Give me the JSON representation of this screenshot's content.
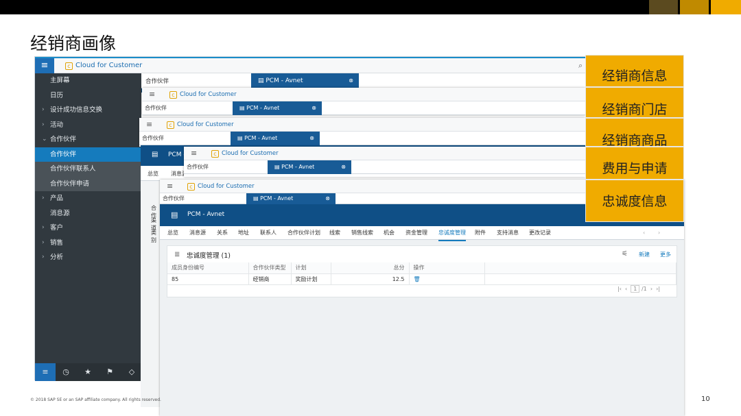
{
  "slide": {
    "title": "经销商画像",
    "footer": "© 2018 SAP SE or an SAP affiliate company. All rights reserved.",
    "page_number": "10",
    "accent_colors": [
      "#5b4a1f",
      "#c08a00",
      "#f0ab00"
    ]
  },
  "app": {
    "brand": "Cloud for Customer",
    "menu_icon": "hamburger-icon",
    "search_icon": "search-icon"
  },
  "sidebar": {
    "items": [
      {
        "label": "主屏幕",
        "chevron": ""
      },
      {
        "label": "日历",
        "chevron": ""
      },
      {
        "label": "设计成功信息交换",
        "chevron": "›"
      },
      {
        "label": "活动",
        "chevron": "›"
      },
      {
        "label": "合作伙伴",
        "chevron": "⌄"
      },
      {
        "label": "合作伙伴",
        "chevron": ""
      },
      {
        "label": "合作伙伴联系人",
        "chevron": ""
      },
      {
        "label": "合作伙伴申请",
        "chevron": ""
      },
      {
        "label": "产品",
        "chevron": "›"
      },
      {
        "label": "消息源",
        "chevron": ""
      },
      {
        "label": "客户",
        "chevron": "›"
      },
      {
        "label": "销售",
        "chevron": "›"
      },
      {
        "label": "分析",
        "chevron": "›"
      }
    ],
    "bottom_icons": [
      "hamburger-icon",
      "clock-icon",
      "star-icon",
      "flag-icon",
      "tag-icon"
    ]
  },
  "windows": {
    "partner_label": "合作伙伴",
    "tab_label": "PCM - Avnet",
    "tab_short": "PCM -",
    "brand": "Cloud for Customer"
  },
  "partial": {
    "tab1": "总览",
    "tab2": "消息源",
    "row1": "合作",
    "row2": "渠道",
    "row3": "类别"
  },
  "front": {
    "header_title": "PCM - Avnet",
    "tabs": [
      "总览",
      "消息源",
      "关系",
      "地址",
      "联系人",
      "合作伙伴计划",
      "线索",
      "销售线索",
      "机会",
      "资金管理",
      "忠诚度管理",
      "附件",
      "支持消息",
      "更改记录"
    ],
    "selected_tab": "忠诚度管理",
    "section_title": "忠诚度管理 (1)",
    "new_button": "新建",
    "more_button": "更多",
    "columns": [
      "成员身份编号",
      "合作伙伴类型",
      "计划",
      "总分",
      "操作"
    ],
    "rows": [
      {
        "member_id": "85",
        "partner_type": "经销商",
        "plan": "奖励计划",
        "total": "12.5"
      }
    ],
    "pagination": {
      "current": "1",
      "total": "/1"
    }
  },
  "callouts": [
    "经销商信息",
    "经销商门店",
    "经销商商品",
    "费用与申请",
    "忠诚度信息"
  ]
}
